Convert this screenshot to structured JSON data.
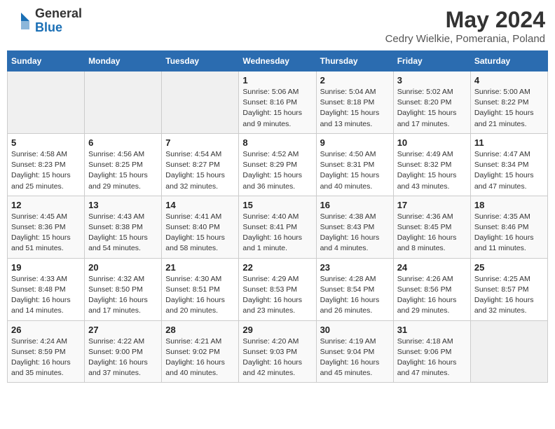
{
  "logo": {
    "general": "General",
    "blue": "Blue"
  },
  "title": "May 2024",
  "subtitle": "Cedry Wielkie, Pomerania, Poland",
  "days_of_week": [
    "Sunday",
    "Monday",
    "Tuesday",
    "Wednesday",
    "Thursday",
    "Friday",
    "Saturday"
  ],
  "weeks": [
    [
      {
        "day": "",
        "info": ""
      },
      {
        "day": "",
        "info": ""
      },
      {
        "day": "",
        "info": ""
      },
      {
        "day": "1",
        "info": "Sunrise: 5:06 AM\nSunset: 8:16 PM\nDaylight: 15 hours and 9 minutes."
      },
      {
        "day": "2",
        "info": "Sunrise: 5:04 AM\nSunset: 8:18 PM\nDaylight: 15 hours and 13 minutes."
      },
      {
        "day": "3",
        "info": "Sunrise: 5:02 AM\nSunset: 8:20 PM\nDaylight: 15 hours and 17 minutes."
      },
      {
        "day": "4",
        "info": "Sunrise: 5:00 AM\nSunset: 8:22 PM\nDaylight: 15 hours and 21 minutes."
      }
    ],
    [
      {
        "day": "5",
        "info": "Sunrise: 4:58 AM\nSunset: 8:23 PM\nDaylight: 15 hours and 25 minutes."
      },
      {
        "day": "6",
        "info": "Sunrise: 4:56 AM\nSunset: 8:25 PM\nDaylight: 15 hours and 29 minutes."
      },
      {
        "day": "7",
        "info": "Sunrise: 4:54 AM\nSunset: 8:27 PM\nDaylight: 15 hours and 32 minutes."
      },
      {
        "day": "8",
        "info": "Sunrise: 4:52 AM\nSunset: 8:29 PM\nDaylight: 15 hours and 36 minutes."
      },
      {
        "day": "9",
        "info": "Sunrise: 4:50 AM\nSunset: 8:31 PM\nDaylight: 15 hours and 40 minutes."
      },
      {
        "day": "10",
        "info": "Sunrise: 4:49 AM\nSunset: 8:32 PM\nDaylight: 15 hours and 43 minutes."
      },
      {
        "day": "11",
        "info": "Sunrise: 4:47 AM\nSunset: 8:34 PM\nDaylight: 15 hours and 47 minutes."
      }
    ],
    [
      {
        "day": "12",
        "info": "Sunrise: 4:45 AM\nSunset: 8:36 PM\nDaylight: 15 hours and 51 minutes."
      },
      {
        "day": "13",
        "info": "Sunrise: 4:43 AM\nSunset: 8:38 PM\nDaylight: 15 hours and 54 minutes."
      },
      {
        "day": "14",
        "info": "Sunrise: 4:41 AM\nSunset: 8:40 PM\nDaylight: 15 hours and 58 minutes."
      },
      {
        "day": "15",
        "info": "Sunrise: 4:40 AM\nSunset: 8:41 PM\nDaylight: 16 hours and 1 minute."
      },
      {
        "day": "16",
        "info": "Sunrise: 4:38 AM\nSunset: 8:43 PM\nDaylight: 16 hours and 4 minutes."
      },
      {
        "day": "17",
        "info": "Sunrise: 4:36 AM\nSunset: 8:45 PM\nDaylight: 16 hours and 8 minutes."
      },
      {
        "day": "18",
        "info": "Sunrise: 4:35 AM\nSunset: 8:46 PM\nDaylight: 16 hours and 11 minutes."
      }
    ],
    [
      {
        "day": "19",
        "info": "Sunrise: 4:33 AM\nSunset: 8:48 PM\nDaylight: 16 hours and 14 minutes."
      },
      {
        "day": "20",
        "info": "Sunrise: 4:32 AM\nSunset: 8:50 PM\nDaylight: 16 hours and 17 minutes."
      },
      {
        "day": "21",
        "info": "Sunrise: 4:30 AM\nSunset: 8:51 PM\nDaylight: 16 hours and 20 minutes."
      },
      {
        "day": "22",
        "info": "Sunrise: 4:29 AM\nSunset: 8:53 PM\nDaylight: 16 hours and 23 minutes."
      },
      {
        "day": "23",
        "info": "Sunrise: 4:28 AM\nSunset: 8:54 PM\nDaylight: 16 hours and 26 minutes."
      },
      {
        "day": "24",
        "info": "Sunrise: 4:26 AM\nSunset: 8:56 PM\nDaylight: 16 hours and 29 minutes."
      },
      {
        "day": "25",
        "info": "Sunrise: 4:25 AM\nSunset: 8:57 PM\nDaylight: 16 hours and 32 minutes."
      }
    ],
    [
      {
        "day": "26",
        "info": "Sunrise: 4:24 AM\nSunset: 8:59 PM\nDaylight: 16 hours and 35 minutes."
      },
      {
        "day": "27",
        "info": "Sunrise: 4:22 AM\nSunset: 9:00 PM\nDaylight: 16 hours and 37 minutes."
      },
      {
        "day": "28",
        "info": "Sunrise: 4:21 AM\nSunset: 9:02 PM\nDaylight: 16 hours and 40 minutes."
      },
      {
        "day": "29",
        "info": "Sunrise: 4:20 AM\nSunset: 9:03 PM\nDaylight: 16 hours and 42 minutes."
      },
      {
        "day": "30",
        "info": "Sunrise: 4:19 AM\nSunset: 9:04 PM\nDaylight: 16 hours and 45 minutes."
      },
      {
        "day": "31",
        "info": "Sunrise: 4:18 AM\nSunset: 9:06 PM\nDaylight: 16 hours and 47 minutes."
      },
      {
        "day": "",
        "info": ""
      }
    ]
  ]
}
